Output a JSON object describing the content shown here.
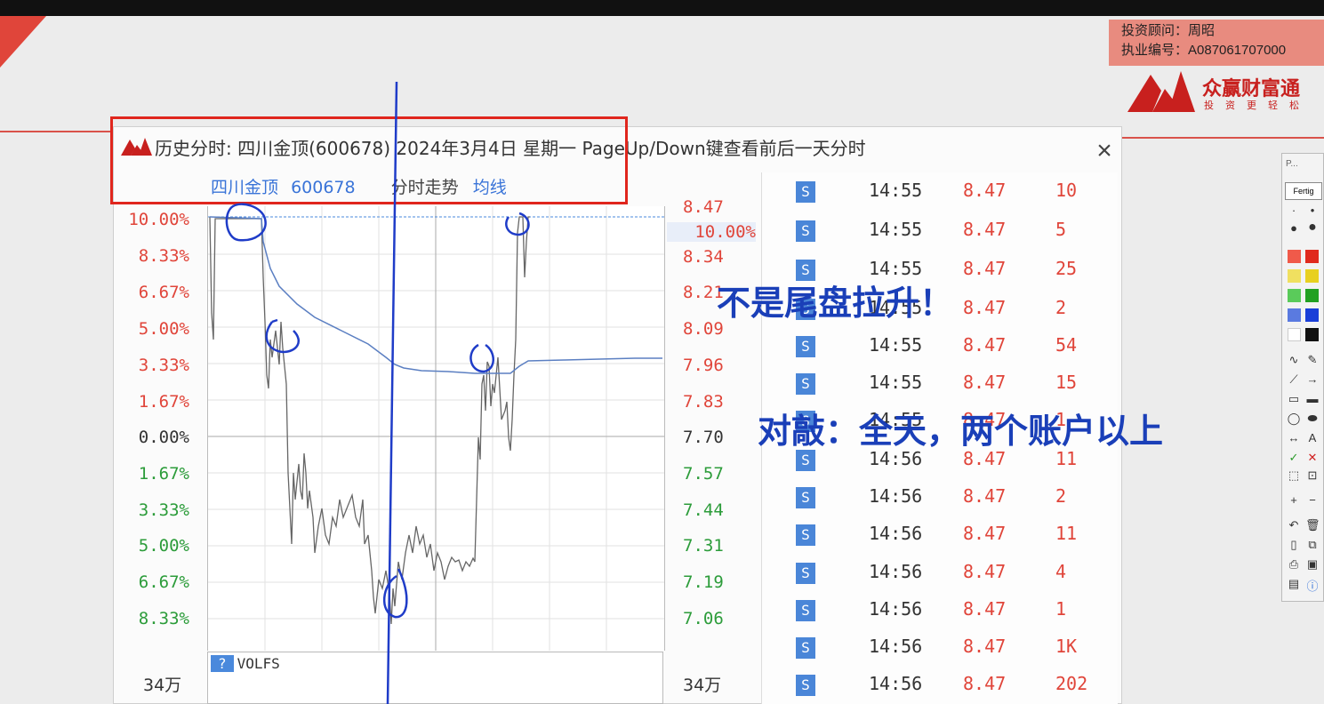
{
  "advisor": {
    "line1": "投资顾问：周昭",
    "line2": "执业编号：A087061707000"
  },
  "brand": {
    "name": "众赢财富通",
    "slogan": "投资更轻松"
  },
  "window": {
    "title": "历史分时: 四川金顶(600678) 2024年3月4日 星期一  PageUp/Down键查看前后一天分时",
    "close": "×",
    "stock_name": "四川金顶",
    "stock_code": "600678",
    "view_label": "分时走势",
    "avg_label": "均线"
  },
  "axis": {
    "pct": [
      "10.00%",
      "8.33%",
      "6.67%",
      "5.00%",
      "3.33%",
      "1.67%",
      "0.00%",
      "1.67%",
      "3.33%",
      "5.00%",
      "6.67%",
      "8.33%"
    ],
    "price": [
      "8.47",
      "10.00%",
      "8.34",
      "8.21",
      "8.09",
      "7.96",
      "7.83",
      "7.70",
      "7.57",
      "7.44",
      "7.31",
      "7.19",
      "7.06"
    ]
  },
  "volume": {
    "indicator": "VOLFS",
    "help": "?",
    "left_label": "34万",
    "right_label": "34万"
  },
  "ticks": [
    {
      "s": "S",
      "time": "14:55",
      "price": "8.47",
      "vol": "10"
    },
    {
      "s": "S",
      "time": "14:55",
      "price": "8.47",
      "vol": "5"
    },
    {
      "s": "S",
      "time": "14:55",
      "price": "8.47",
      "vol": "25"
    },
    {
      "s": "S",
      "time": "14:55",
      "price": "8.47",
      "vol": "2"
    },
    {
      "s": "S",
      "time": "14:55",
      "price": "8.47",
      "vol": "54"
    },
    {
      "s": "S",
      "time": "14:55",
      "price": "8.47",
      "vol": "15"
    },
    {
      "s": "S",
      "time": "14:55",
      "price": "8.47",
      "vol": "1"
    },
    {
      "s": "S",
      "time": "14:56",
      "price": "8.47",
      "vol": "11"
    },
    {
      "s": "S",
      "time": "14:56",
      "price": "8.47",
      "vol": "2"
    },
    {
      "s": "S",
      "time": "14:56",
      "price": "8.47",
      "vol": "11"
    },
    {
      "s": "S",
      "time": "14:56",
      "price": "8.47",
      "vol": "4"
    },
    {
      "s": "S",
      "time": "14:56",
      "price": "8.47",
      "vol": "1"
    },
    {
      "s": "S",
      "time": "14:56",
      "price": "8.47",
      "vol": "1K"
    },
    {
      "s": "S",
      "time": "14:56",
      "price": "8.47",
      "vol": "202"
    }
  ],
  "annotations": {
    "line1": "不是尾盘拉升！",
    "line2": "对敲：全天，两个账户以上"
  },
  "toolpanel": {
    "title": "P...",
    "button": "Fertig"
  },
  "colors": {
    "up": "#e0453a",
    "down": "#2c9c3a",
    "accent": "#3a74d8",
    "annotation": "#1a3fb8",
    "highlight_box": "#e0261d"
  }
}
